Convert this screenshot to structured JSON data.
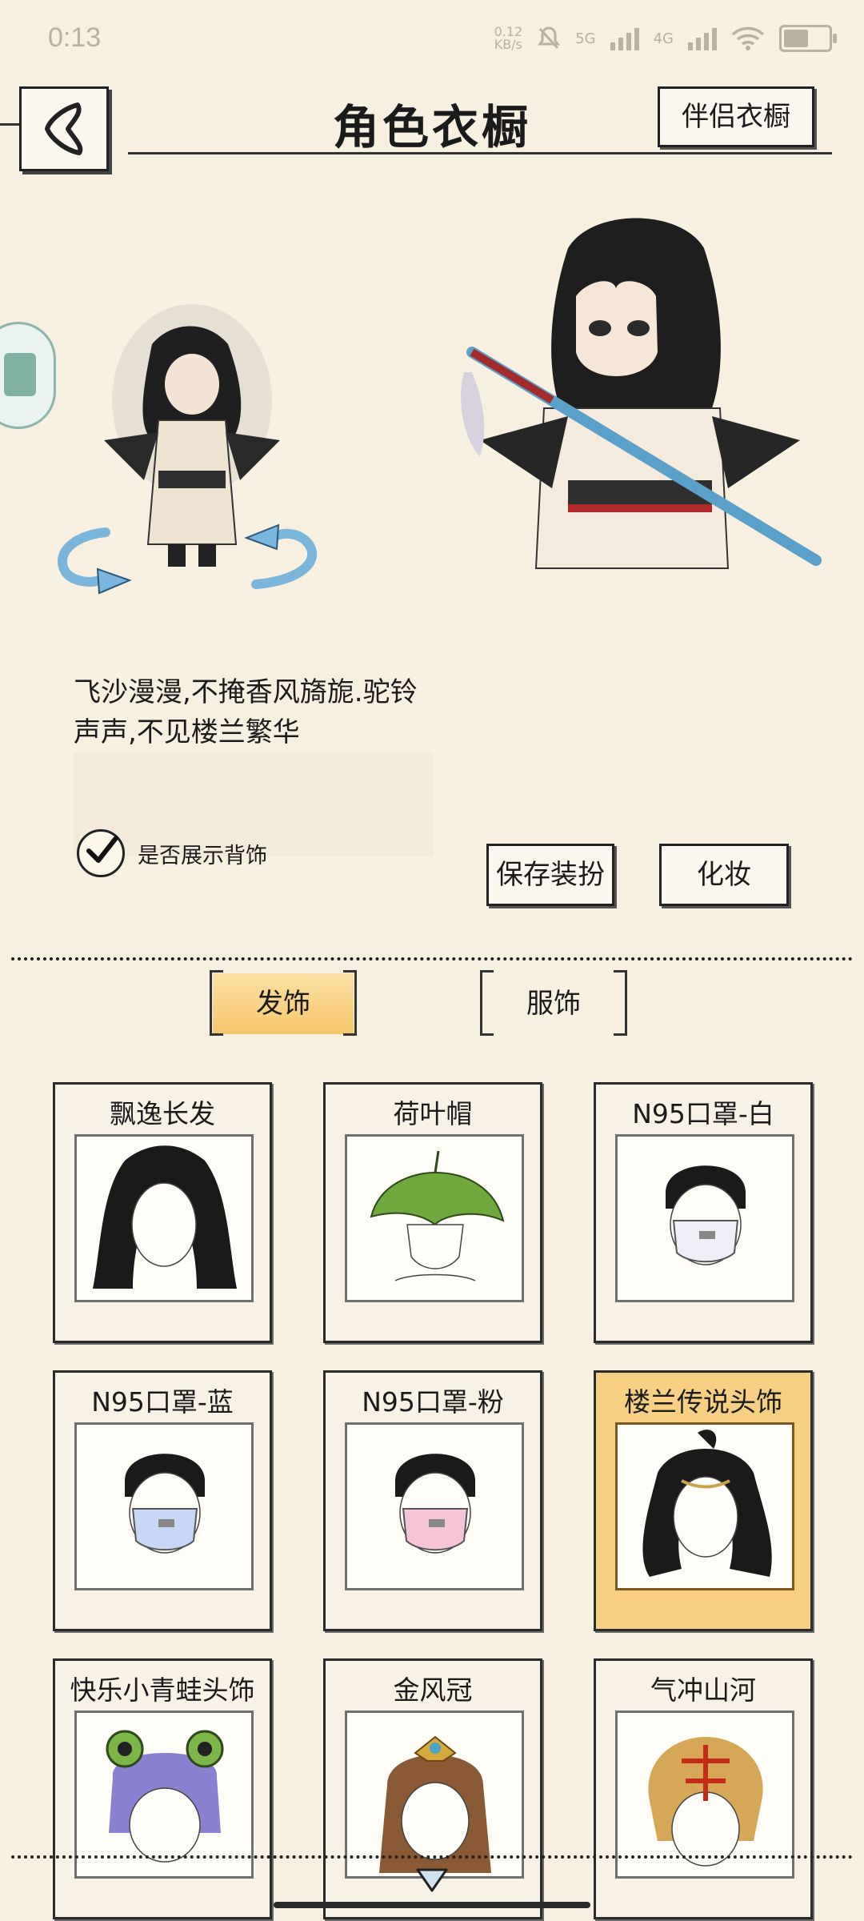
{
  "status": {
    "time": "0:13",
    "speed": "0.12\nKB/s",
    "net1": "5G",
    "net2": "4G",
    "battery_level": 0.55
  },
  "header": {
    "title": "角色衣橱",
    "partner_button": "伴侣衣橱"
  },
  "preview": {
    "description": "飞沙漫漫,不掩香风旖旎.驼铃声声,不见楼兰繁华",
    "show_back_accessory_label": "是否展示背饰",
    "show_back_accessory_checked": true
  },
  "actions": {
    "save": "保存装扮",
    "makeup": "化妆"
  },
  "tabs": [
    {
      "label": "发饰",
      "active": true
    },
    {
      "label": "服饰",
      "active": false
    }
  ],
  "items": [
    {
      "name": "飘逸长发",
      "icon": "long-hair",
      "selected": false
    },
    {
      "name": "荷叶帽",
      "icon": "lotus-leaf-hat",
      "selected": false
    },
    {
      "name": "N95口罩-白",
      "icon": "mask-white",
      "selected": false
    },
    {
      "name": "N95口罩-蓝",
      "icon": "mask-blue",
      "selected": false
    },
    {
      "name": "N95口罩-粉",
      "icon": "mask-pink",
      "selected": false
    },
    {
      "name": "楼兰传说头饰",
      "icon": "loulan-headwear",
      "selected": true
    },
    {
      "name": "快乐小青蛙头饰",
      "icon": "frog-headwear",
      "selected": false
    },
    {
      "name": "金风冠",
      "icon": "golden-crown",
      "selected": false
    },
    {
      "name": "气冲山河",
      "icon": "fiery-headwear",
      "selected": false
    }
  ],
  "colors": {
    "background": "#f7efe0",
    "selected_card": "#f7cf83",
    "active_tab": "#f6c66a"
  }
}
